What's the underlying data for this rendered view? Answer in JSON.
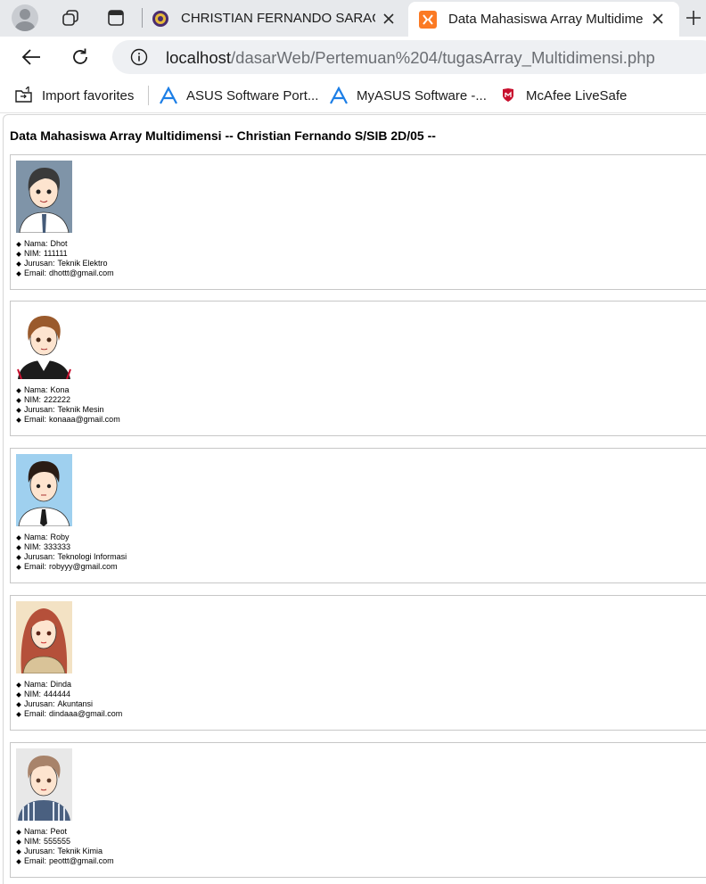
{
  "tabs": [
    {
      "title": "CHRISTIAN FERNANDO SARAGIH",
      "active": false
    },
    {
      "title": "Data Mahasiswa Array Multidimensi",
      "active": true
    }
  ],
  "address": {
    "host": "localhost",
    "path": "/dasarWeb/Pertemuan%204/tugasArray_Multidimensi.php"
  },
  "favorites": [
    {
      "label": "Import favorites",
      "icon": "import-favorites-icon"
    },
    {
      "label": "ASUS Software Port...",
      "icon": "asus-icon"
    },
    {
      "label": "MyASUS Software -...",
      "icon": "asus-icon"
    },
    {
      "label": "McAfee LiveSafe",
      "icon": "mcafee-icon"
    }
  ],
  "page": {
    "title": "Data Mahasiswa Array Multidimensi -- Christian Fernando S/SIB 2D/05 --",
    "labels": {
      "nama": "Nama:",
      "nim": "NIM:",
      "jurusan": "Jurusan:",
      "email": "Email:"
    },
    "students": [
      {
        "nama": "Dhot",
        "nim": "111111",
        "jurusan": "Teknik Elektro",
        "email": "dhottt@gmail.com",
        "photo_bg": "#7f94a8"
      },
      {
        "nama": "Kona",
        "nim": "222222",
        "jurusan": "Teknik Mesin",
        "email": "konaaa@gmail.com",
        "photo_bg": "#ffffff"
      },
      {
        "nama": "Roby",
        "nim": "333333",
        "jurusan": "Teknologi Informasi",
        "email": "robyyy@gmail.com",
        "photo_bg": "#9fd0ef"
      },
      {
        "nama": "Dinda",
        "nim": "444444",
        "jurusan": "Akuntansi",
        "email": "dindaaa@gmail.com",
        "photo_bg": "#f3e2c4"
      },
      {
        "nama": "Peot",
        "nim": "555555",
        "jurusan": "Teknik Kimia",
        "email": "peottt@gmail.com",
        "photo_bg": "#e8e8e8"
      }
    ]
  },
  "colors": {
    "tabstrip": "#e7e9ec",
    "omnibox": "#eef0f3",
    "xampp_orange": "#fb7a24",
    "asus_blue": "#1c7ee6",
    "mcafee_red": "#c8102e"
  }
}
